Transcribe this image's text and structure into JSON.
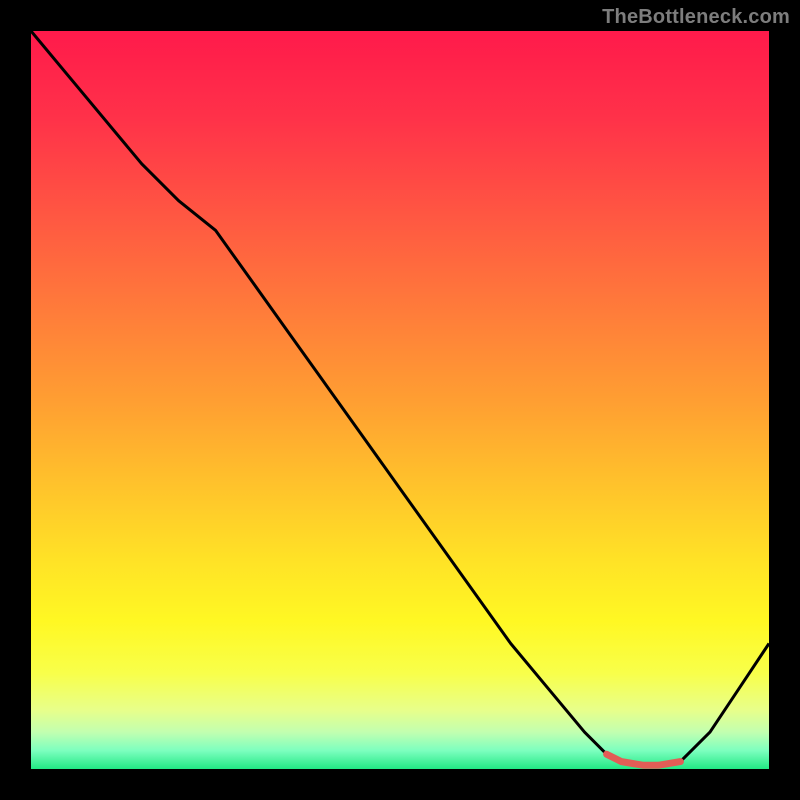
{
  "attribution": "TheBottleneck.com",
  "colors": {
    "bg": "#000000",
    "attribution_text": "#7d7d7d",
    "curve": "#000000",
    "highlight": "#e25d56",
    "gradient_stops": [
      {
        "offset": 0.0,
        "color": "#ff1a4b"
      },
      {
        "offset": 0.12,
        "color": "#ff3249"
      },
      {
        "offset": 0.25,
        "color": "#ff5742"
      },
      {
        "offset": 0.38,
        "color": "#ff7c3a"
      },
      {
        "offset": 0.5,
        "color": "#ff9e32"
      },
      {
        "offset": 0.62,
        "color": "#ffc42b"
      },
      {
        "offset": 0.72,
        "color": "#ffe326"
      },
      {
        "offset": 0.8,
        "color": "#fff823"
      },
      {
        "offset": 0.87,
        "color": "#f8ff4a"
      },
      {
        "offset": 0.92,
        "color": "#e8ff8a"
      },
      {
        "offset": 0.95,
        "color": "#c2ffb0"
      },
      {
        "offset": 0.975,
        "color": "#7dffbf"
      },
      {
        "offset": 1.0,
        "color": "#22e884"
      }
    ]
  },
  "chart_data": {
    "type": "line",
    "title": "",
    "xlabel": "",
    "ylabel": "",
    "xlim": [
      0,
      100
    ],
    "ylim": [
      0,
      100
    ],
    "grid": false,
    "legend": false,
    "annotations": [],
    "series": [
      {
        "name": "curve",
        "x": [
          0,
          5,
          10,
          15,
          20,
          25,
          30,
          35,
          40,
          45,
          50,
          55,
          60,
          65,
          70,
          75,
          78,
          80,
          83,
          85,
          88,
          92,
          96,
          100
        ],
        "values": [
          100,
          94,
          88,
          82,
          77,
          73,
          66,
          59,
          52,
          45,
          38,
          31,
          24,
          17,
          11,
          5,
          2,
          1,
          0.5,
          0.5,
          1,
          5,
          11,
          17
        ]
      }
    ],
    "highlight_segment": {
      "series": "curve",
      "x_start": 78,
      "x_end": 88,
      "note": "flat bottom segment rendered in accent color"
    }
  }
}
